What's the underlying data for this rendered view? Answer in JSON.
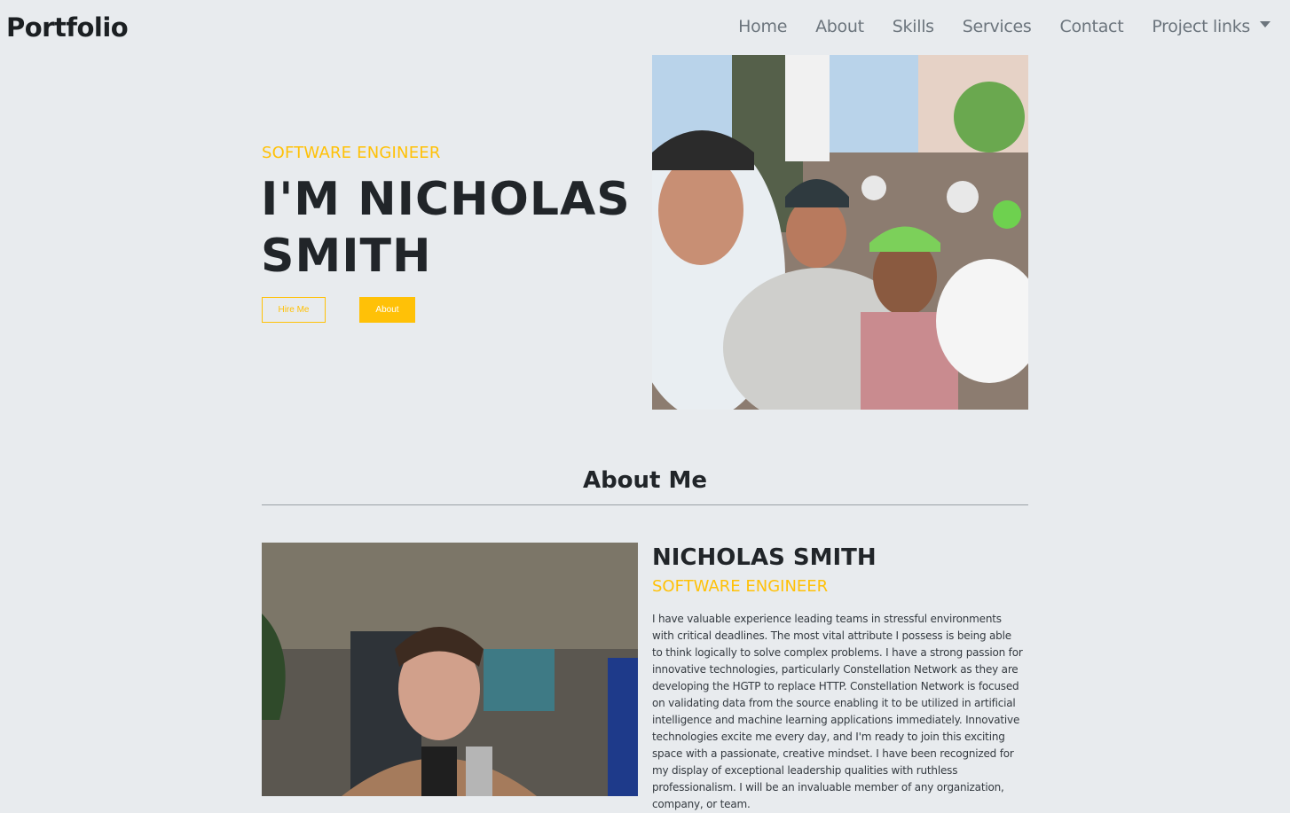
{
  "navbar": {
    "brand": "Portfolio",
    "links": [
      "Home",
      "About",
      "Skills",
      "Services",
      "Contact",
      "Project links"
    ]
  },
  "hero": {
    "subtitle": "SOFTWARE ENGINEER",
    "title": "I'M NICHOLAS SMITH",
    "hire_button": "Hire Me",
    "about_button": "About"
  },
  "about": {
    "heading": "About Me",
    "name": "NICHOLAS SMITH",
    "role": "SOFTWARE ENGINEER",
    "bio": "I have valuable experience leading teams in stressful environments with critical deadlines. The most vital attribute I possess is being able to think logically to solve complex problems. I have a strong passion for innovative technologies, particularly Constellation Network as they are developing the HGTP to replace HTTP. Constellation Network is focused on validating data from the source enabling it to be utilized in artificial intelligence and machine learning applications immediately. Innovative technologies excite me every day, and I'm ready to join this exciting space with a passionate, creative mindset. I have been recognized for my display of exceptional leadership qualities with ruthless professionalism. I will be an invaluable member of any organization, company, or team."
  },
  "colors": {
    "accent": "#ffc107",
    "background": "#e8ebee",
    "text": "#212529"
  }
}
